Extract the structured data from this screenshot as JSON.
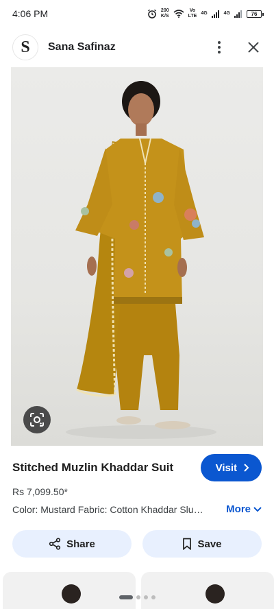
{
  "status_bar": {
    "time": "4:06 PM",
    "speed_value": "200",
    "speed_unit": "K/S",
    "volte_top": "Vo",
    "volte_bottom": "LTE",
    "network1": "4G",
    "network2": "4G",
    "battery": "76"
  },
  "header": {
    "logo_letter": "S",
    "site_name": "Sana Safinaz"
  },
  "product": {
    "title": "Stitched Muzlin Khaddar Suit",
    "visit_label": "Visit",
    "price": "Rs 7,099.50*",
    "description": "Color: Mustard Fabric: Cotton Khaddar Slu…",
    "more_label": "More"
  },
  "actions": {
    "share_label": "Share",
    "save_label": "Save"
  },
  "colors": {
    "accent": "#0b57d0",
    "tonal_button": "#e8f0fe",
    "garment": "#b8860b"
  },
  "icons": [
    "alarm-icon",
    "wifi-icon",
    "signal-icon",
    "battery-icon",
    "more-vert-icon",
    "close-icon",
    "lens-icon",
    "chevron-right-icon",
    "chevron-down-icon",
    "share-icon",
    "bookmark-icon"
  ]
}
